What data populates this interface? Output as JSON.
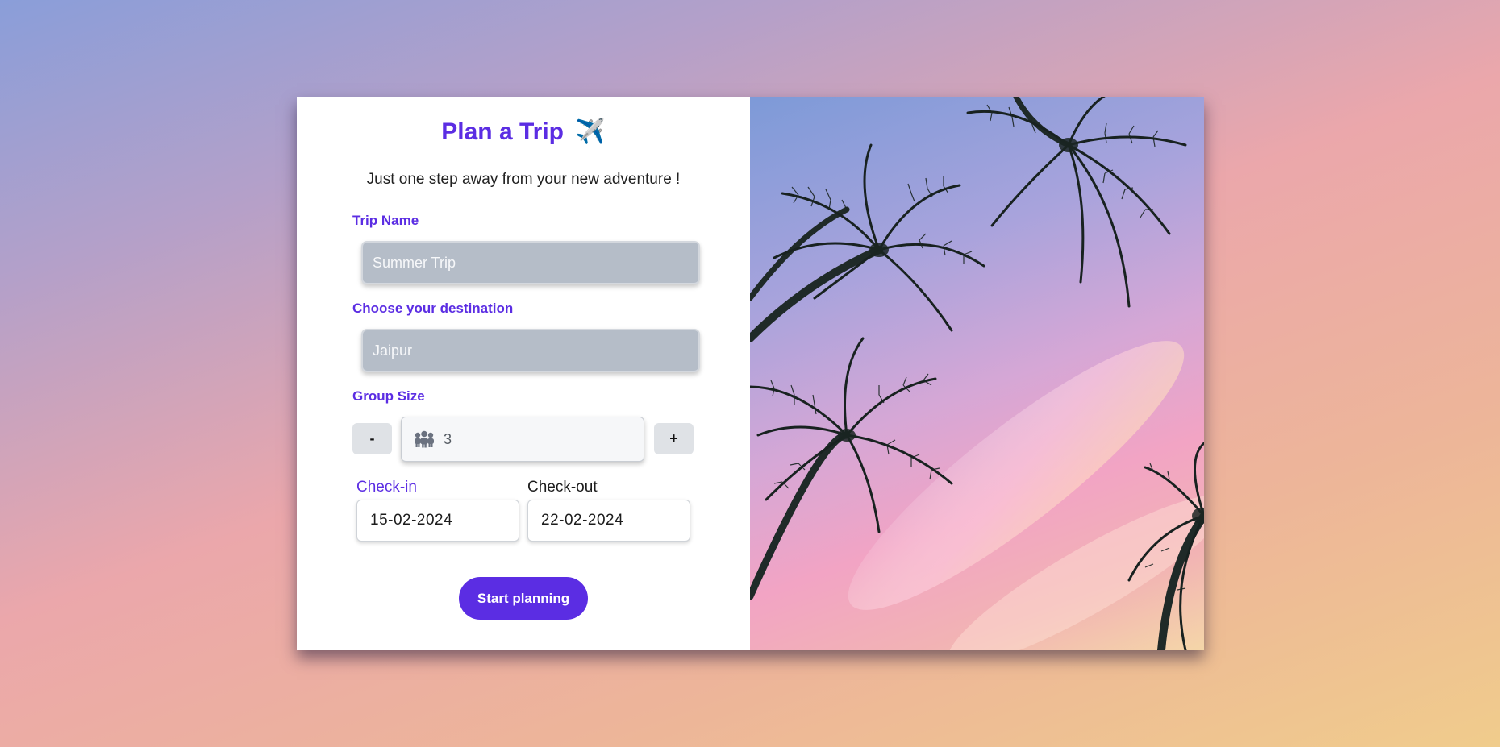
{
  "form": {
    "title": "Plan a Trip",
    "title_emoji": "✈️",
    "subtitle": "Just one step away from your new adventure !",
    "trip_name": {
      "label": "Trip Name",
      "value": "Summer Trip"
    },
    "destination": {
      "label": "Choose your destination",
      "value": "Jaipur"
    },
    "group_size": {
      "label": "Group Size",
      "decrement_label": "-",
      "increment_label": "+",
      "value": "3",
      "icon": "group-people-icon"
    },
    "check_in": {
      "label": "Check-in",
      "value": "15-02-2024"
    },
    "check_out": {
      "label": "Check-out",
      "value": "22-02-2024"
    },
    "submit_label": "Start planning"
  },
  "colors": {
    "accent": "#5b2de3",
    "input_fill": "#b5bdc8",
    "button_gray": "#dfe2e6"
  },
  "image": {
    "subject": "palm-trees-against-sunset-sky"
  }
}
